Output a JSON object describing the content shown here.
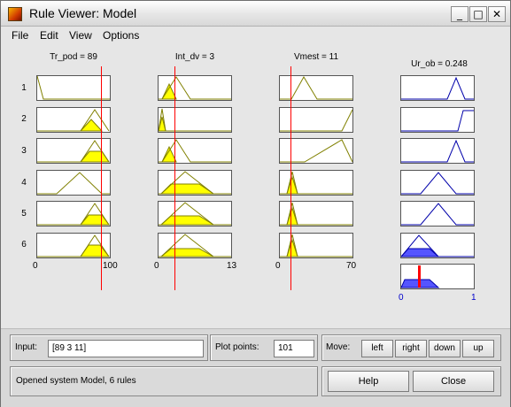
{
  "window": {
    "title": "Rule Viewer: Model",
    "minimize_glyph": "_",
    "maximize_glyph": "□",
    "close_glyph": "✕"
  },
  "menu": [
    "File",
    "Edit",
    "View",
    "Options"
  ],
  "inputs": [
    {
      "title": "Tr_pod = 89",
      "range_min": "0",
      "range_max": "100",
      "value": 89,
      "min": 0,
      "max": 100
    },
    {
      "title": "Int_dv = 3",
      "range_min": "0",
      "range_max": "13",
      "value": 3,
      "min": 0,
      "max": 13
    },
    {
      "title": "Vmest = 11",
      "range_min": "0",
      "range_max": "70",
      "value": 11,
      "min": 0,
      "max": 70
    }
  ],
  "output": {
    "title": "Ur_ob = 0.248",
    "range_min": "0",
    "range_max": "1",
    "value": 0.248
  },
  "rules": [
    "1",
    "2",
    "3",
    "4",
    "5",
    "6"
  ],
  "colors": {
    "input_fill": "#ffff00",
    "input_line": "#808000",
    "output_line": "#0000aa",
    "output_fill": "#5555ff",
    "index_line": "#ff0000",
    "axis_labels": "#0000cc"
  },
  "bottom": {
    "input_label": "Input:",
    "input_value": "[89 3 11]",
    "plot_points_label": "Plot points:",
    "plot_points_value": "101",
    "move_label": "Move:",
    "move_buttons": [
      "left",
      "right",
      "down",
      "up"
    ],
    "status": "Opened system Model, 6 rules",
    "help_label": "Help",
    "close_label": "Close"
  }
}
